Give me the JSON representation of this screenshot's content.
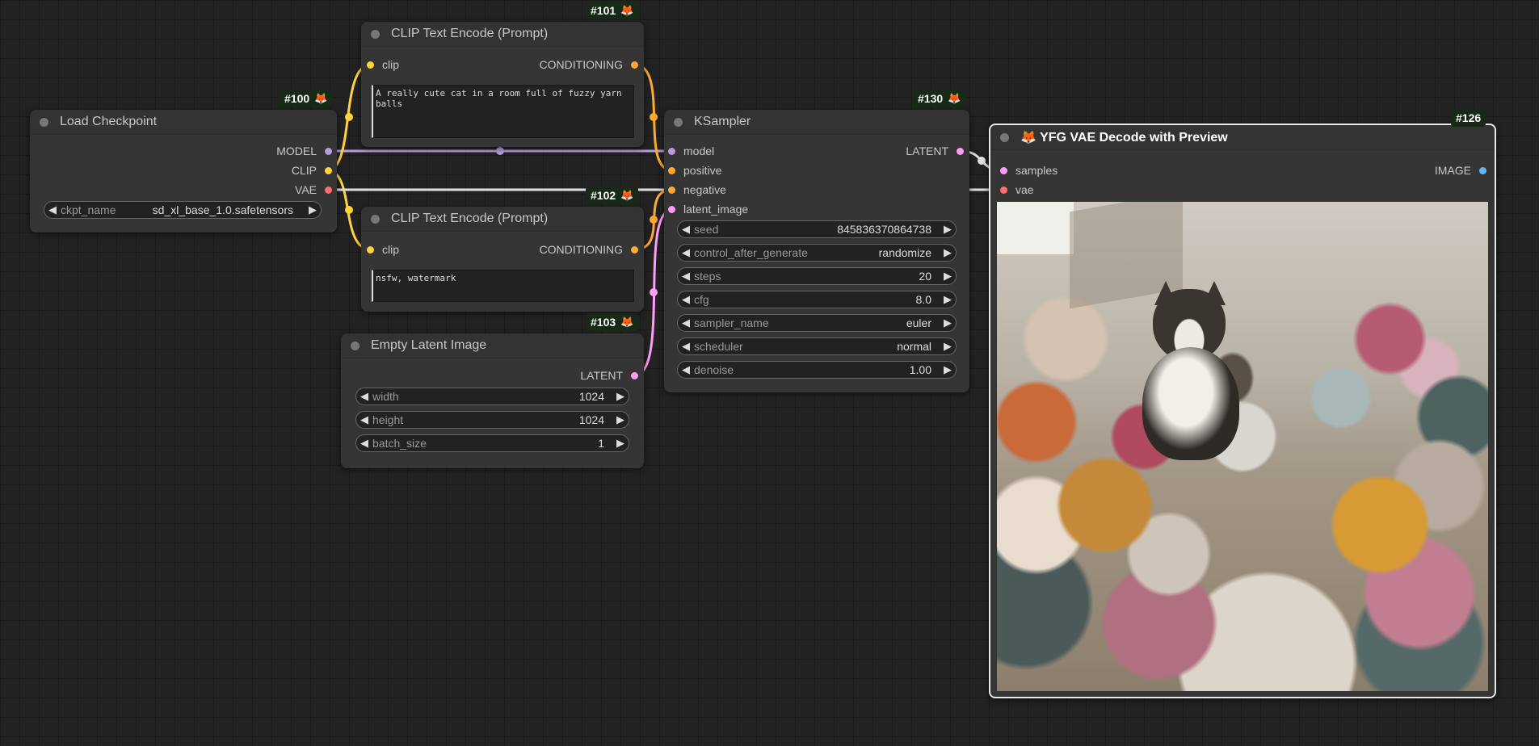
{
  "nodes": {
    "load_checkpoint": {
      "id": "#100",
      "title": "Load Checkpoint",
      "outputs": [
        "MODEL",
        "CLIP",
        "VAE"
      ],
      "widgets": [
        {
          "name": "ckpt_name",
          "value": "sd_xl_base_1.0.safetensors"
        }
      ]
    },
    "clip_positive": {
      "id": "#101",
      "title": "CLIP Text Encode (Prompt)",
      "input": "clip",
      "output": "CONDITIONING",
      "text": "A really cute cat in a room full of fuzzy yarn balls"
    },
    "clip_negative": {
      "id": "#102",
      "title": "CLIP Text Encode (Prompt)",
      "input": "clip",
      "output": "CONDITIONING",
      "text": "nsfw, watermark"
    },
    "empty_latent": {
      "id": "#103",
      "title": "Empty Latent Image",
      "output": "LATENT",
      "widgets": [
        {
          "name": "width",
          "value": "1024"
        },
        {
          "name": "height",
          "value": "1024"
        },
        {
          "name": "batch_size",
          "value": "1"
        }
      ]
    },
    "ksampler": {
      "id": "#130",
      "title": "KSampler",
      "inputs": [
        "model",
        "positive",
        "negative",
        "latent_image"
      ],
      "output": "LATENT",
      "widgets": [
        {
          "name": "seed",
          "value": "845836370864738"
        },
        {
          "name": "control_after_generate",
          "value": "randomize"
        },
        {
          "name": "steps",
          "value": "20"
        },
        {
          "name": "cfg",
          "value": "8.0"
        },
        {
          "name": "sampler_name",
          "value": "euler"
        },
        {
          "name": "scheduler",
          "value": "normal"
        },
        {
          "name": "denoise",
          "value": "1.00"
        }
      ]
    },
    "vae_decode": {
      "id": "#126",
      "title": "🦊 YFG VAE Decode with Preview",
      "inputs": [
        "samples",
        "vae"
      ],
      "output": "IMAGE"
    }
  },
  "badge_icon": "fox-icon",
  "colors": {
    "model": "#b39ddb",
    "clip": "#ffd33d",
    "vae": "#ff6e6e",
    "conditioning": "#ffa931",
    "latent": "#ff9cf9",
    "image": "#64b5f6",
    "badge_bg": "#172917",
    "node_bg": "#353535",
    "canvas_bg": "#222222"
  }
}
